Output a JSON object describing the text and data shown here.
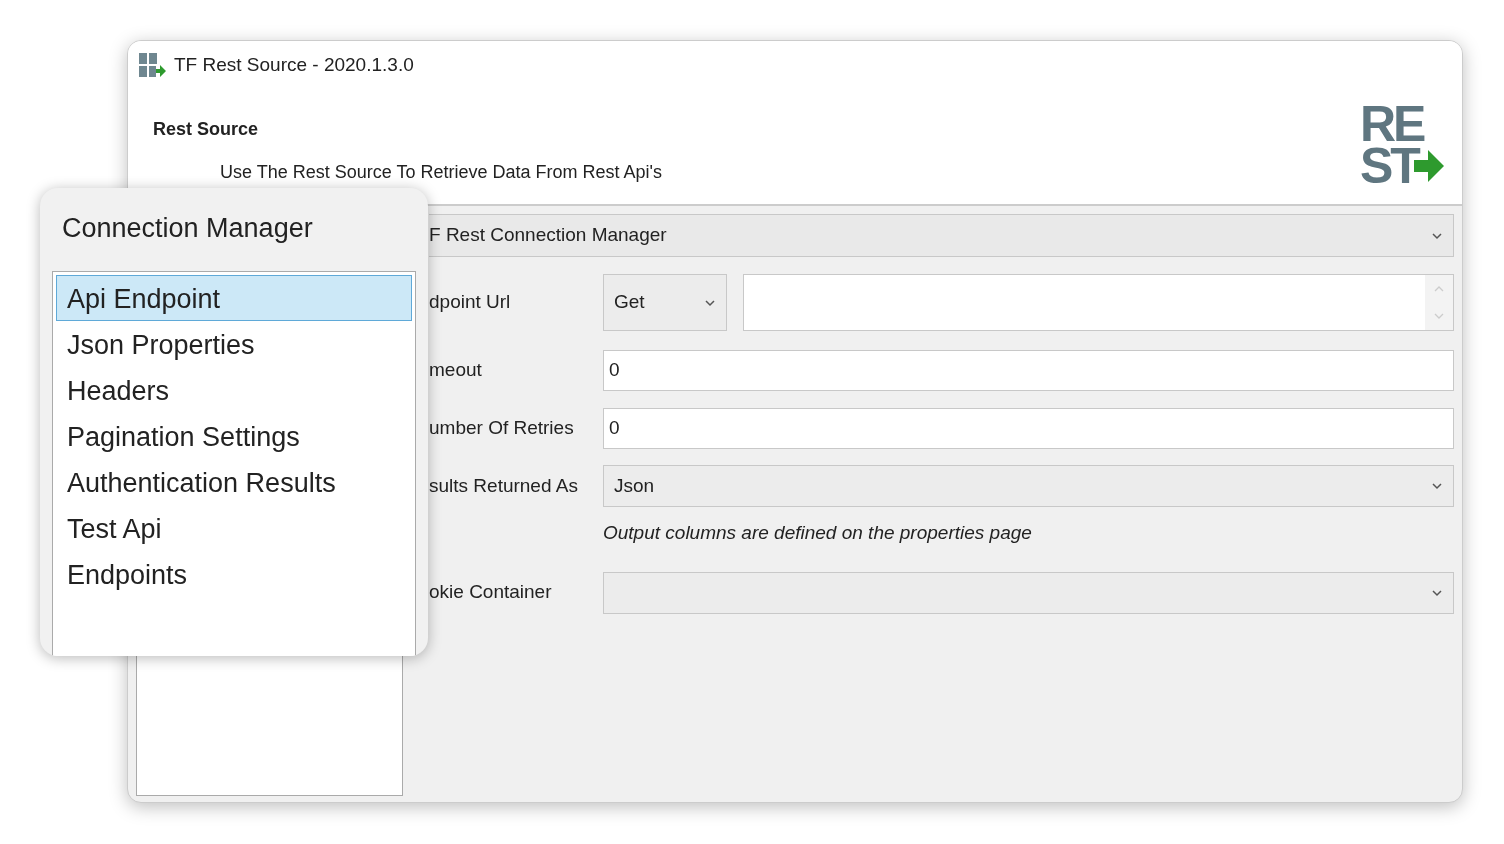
{
  "window": {
    "title": "TF Rest Source - 2020.1.3.0"
  },
  "header": {
    "title": "Rest Source",
    "description": "Use The Rest Source To Retrieve Data From Rest Api's",
    "logo": {
      "line_1": "RE",
      "line_2": "ST"
    }
  },
  "popup": {
    "title": "Connection Manager",
    "items": [
      {
        "label": "Api Endpoint",
        "selected": true
      },
      {
        "label": "Json Properties",
        "selected": false
      },
      {
        "label": "Headers",
        "selected": false
      },
      {
        "label": "Pagination Settings",
        "selected": false
      },
      {
        "label": "Authentication Results",
        "selected": false
      },
      {
        "label": "Test Api",
        "selected": false
      },
      {
        "label": "Endpoints",
        "selected": false
      }
    ]
  },
  "form": {
    "connection_manager": {
      "value": "F Rest Connection Manager"
    },
    "rows": [
      {
        "kind": "endpoint",
        "label": "dpoint Url",
        "method": "Get"
      },
      {
        "kind": "text",
        "label": "meout",
        "value": "0"
      },
      {
        "kind": "text",
        "label": "umber Of Retries",
        "value": "0"
      },
      {
        "kind": "select",
        "label": "sults Returned As",
        "value": "Json"
      },
      {
        "kind": "note",
        "text": "Output columns are defined on the properties page"
      },
      {
        "kind": "select",
        "label": "okie Container"
      }
    ]
  }
}
